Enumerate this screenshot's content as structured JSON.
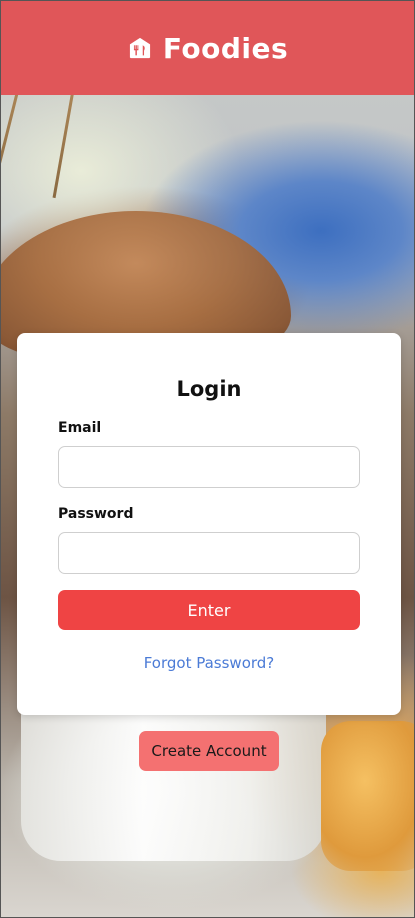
{
  "header": {
    "brand": "Foodies",
    "logo_icon": "house-utensils-icon",
    "background_color": "#e05659"
  },
  "login": {
    "title": "Login",
    "email_label": "Email",
    "email_value": "",
    "password_label": "Password",
    "password_value": "",
    "enter_label": "Enter",
    "forgot_label": "Forgot Password?"
  },
  "create_account_label": "Create Account",
  "colors": {
    "primary_button": "#ef4444",
    "secondary_button": "#f47171",
    "link": "#4b7bd6"
  }
}
